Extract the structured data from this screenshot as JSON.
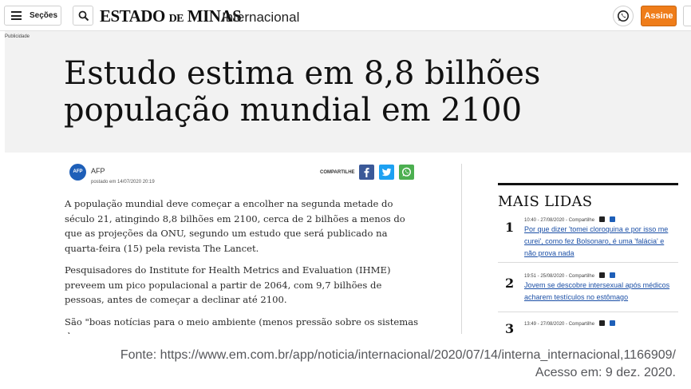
{
  "header": {
    "menu_label": "Seções",
    "logo_main": "ESTADO",
    "logo_de": "DE",
    "logo_tail": "MINAS",
    "section": "Internacional",
    "subscribe_label": "Assine"
  },
  "hero": {
    "ad_label": "Publicidade",
    "headline": "Estudo estima em 8,8 bilhões população mundial em 2100"
  },
  "article": {
    "agency_logo": "AFP",
    "author": "AFP",
    "posted": "postado em 14/07/2020 20:19",
    "share_label": "COMPARTILHE",
    "paragraphs": [
      "A população mundial deve começar a encolher na segunda metade do século 21, atingindo 8,8 bilhões em 2100, cerca de 2 bilhões a menos do que as projeções da ONU, segundo um estudo que será publicado na quarta-feira (15) pela revista The Lancet.",
      "Pesquisadores do Institute for Health Metrics and Evaluation (IHME) preveem um pico populacional a partir de 2064, com 9,7 bilhões de pessoas, antes de começar a declinar até 2100.",
      "São \"boas notícias para o meio ambiente (menos pressão sobre os sistemas de"
    ]
  },
  "sidebar": {
    "title": "MAIS LIDAS",
    "items": [
      {
        "rank": "1",
        "meta": "10:40 - 27/08/2020 - Compartilhe",
        "title": "Por que dizer 'tomei cloroquina e por isso me curei', como fez Bolsonaro, é uma 'falácia' e não prova nada"
      },
      {
        "rank": "2",
        "meta": "19:51 - 25/08/2020 - Compartilhe",
        "title": "Jovem se descobre intersexual após médicos acharem testículos no estômago"
      },
      {
        "rank": "3",
        "meta": "13:49 - 27/08/2020 - Compartilhe",
        "title": ""
      }
    ]
  },
  "caption": {
    "source": "Fonte: https://www.em.com.br/app/noticia/internacional/2020/07/14/interna_internacional,1166909/",
    "access": "Acesso em: 9 dez. 2020."
  },
  "colors": {
    "accent": "#ef7d1a",
    "link": "#1b4fa6",
    "facebook": "#3b5998",
    "twitter": "#1da1f2",
    "whatsapp": "#4caf50"
  }
}
